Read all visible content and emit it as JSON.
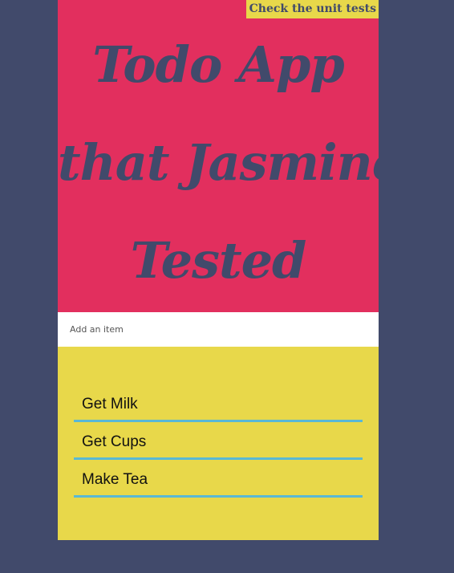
{
  "header": {
    "unit_tests_link": "Check the unit tests",
    "title_lines": [
      "Todo App",
      "that Jasmine",
      "Tested"
    ]
  },
  "add_item": {
    "placeholder": "Add an item",
    "value": ""
  },
  "todos": [
    "Get Milk",
    "Get Cups",
    "Make Tea"
  ],
  "colors": {
    "page_background": "#414a6b",
    "hero_background": "#e22f5e",
    "list_background": "#e8d84a",
    "item_underline": "#5ab8d4"
  }
}
